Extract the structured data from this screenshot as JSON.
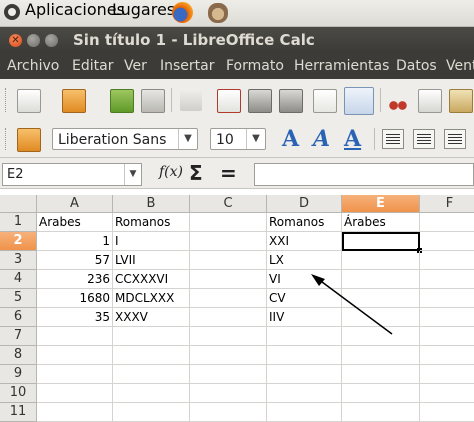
{
  "panel": {
    "menus": [
      "Aplicaciones",
      "Lugares"
    ],
    "launchers": [
      "firefox-icon",
      "gimp-icon"
    ]
  },
  "window": {
    "title": "Sin título 1 - LibreOffice Calc",
    "controls": [
      "close",
      "minimize",
      "maximize"
    ]
  },
  "menubar": [
    "Archivo",
    "Editar",
    "Ver",
    "Insertar",
    "Formato",
    "Herramientas",
    "Datos",
    "Vent"
  ],
  "formatting": {
    "font_name": "Liberation Sans",
    "font_size": "10"
  },
  "formula_bar": {
    "name_box": "E2",
    "fx_label": "f(x)",
    "sigma": "Σ",
    "equals": "=",
    "content": ""
  },
  "sheet": {
    "columns": [
      "A",
      "B",
      "C",
      "D",
      "E",
      "F"
    ],
    "selected_column": "E",
    "rows": [
      "1",
      "2",
      "3",
      "4",
      "5",
      "6",
      "7",
      "8",
      "9",
      "10",
      "11"
    ],
    "selected_row": "2",
    "active_cell": "E2",
    "cells": {
      "A1": "Arabes",
      "B1": "Romanos",
      "D1": "Romanos",
      "E1": "Árabes",
      "A2": "1",
      "B2": "I",
      "D2": "XXI",
      "A3": "57",
      "B3": "LVII",
      "D3": "LX",
      "A4": "236",
      "B4": "CCXXXVI",
      "D4": "VI",
      "A5": "1680",
      "B5": "MDCLXXX",
      "D5": "CV",
      "A6": "35",
      "B6": "XXXV",
      "D6": "IIV"
    }
  },
  "colors": {
    "selection_header": "#f0934b",
    "menubar_bg": "#3c3b37",
    "toolbar_bg": "#eeede9"
  }
}
